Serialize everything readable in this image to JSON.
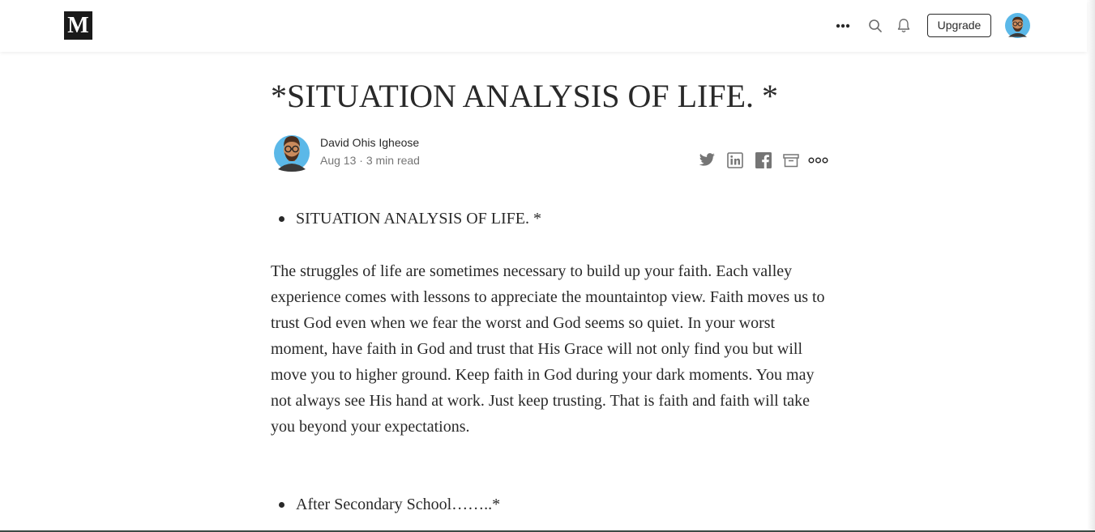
{
  "header": {
    "logo_text": "M",
    "more_icon": "ellipsis-icon",
    "search_icon": "search-icon",
    "notifications_icon": "bell-icon",
    "upgrade_label": "Upgrade",
    "avatar_icon": "user-avatar"
  },
  "article": {
    "title": "*SITUATION ANALYSIS OF LIFE. *",
    "author": {
      "name": "David Ohis Igheose",
      "meta": "Aug 13 · 3 min read"
    },
    "share_icons": [
      "twitter-icon",
      "linkedin-icon",
      "facebook-icon",
      "bookmark-icon",
      "more-icon"
    ],
    "bullet_1": "SITUATION ANALYSIS OF LIFE. *",
    "paragraph": "The struggles of life are sometimes necessary to build up your faith. Each valley experience comes with lessons to appreciate the mountaintop view. Faith moves us to trust God even when we fear the worst and God seems so quiet. In your worst moment, have faith in God and trust that His Grace will not only find you but will move you to higher ground. Keep faith in God during your dark moments. You may not always see His hand at work. Just keep trusting. That is faith and faith will take you beyond your expectations.",
    "bullet_2": "After Secondary School……..*"
  },
  "colors": {
    "text": "#292929",
    "meta": "#757575",
    "logo_bg": "#1a1a1a",
    "avatar_bg": "#5bb8e8"
  }
}
